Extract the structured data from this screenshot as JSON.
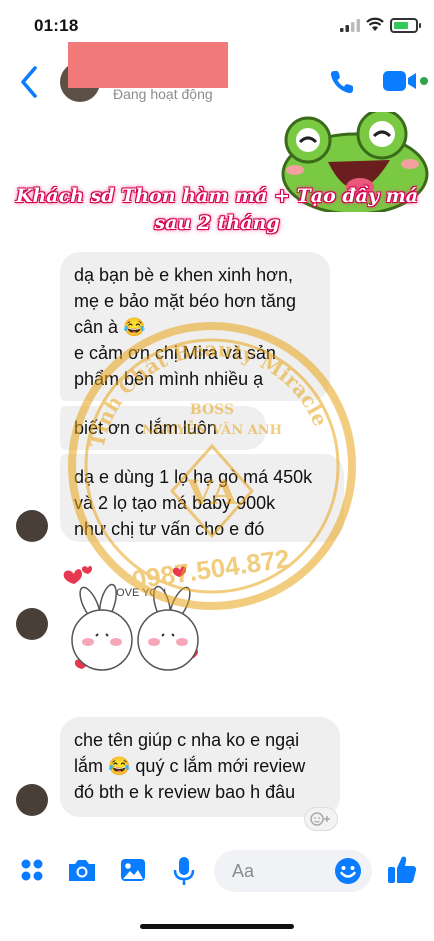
{
  "status_bar": {
    "time": "01:18"
  },
  "header": {
    "active_status": "Đang hoạt động"
  },
  "promo_text": {
    "line1": "Khách sd Thon hàm má + Tạo đầy má",
    "line2": "sau 2 tháng"
  },
  "messages": [
    {
      "lines": [
        "dạ bạn bè e khen xinh hơn,",
        "mẹ e bảo mặt béo hơn tăng",
        "cân à 😂",
        "e cảm ơn chị Mira và sản",
        "phẩm bên mình nhiều ạ"
      ]
    },
    {
      "lines": [
        "biết ơn c lắm luôn"
      ]
    },
    {
      "lines": [
        "dạ e dùng 1 lọ hạ gò má 450k",
        "và 2 lọ tạo má baby 900k",
        "như chị tư vấn cho e đó"
      ]
    },
    {
      "lines": [
        "che tên giúp c nha ko e ngại",
        "lắm 😂 quý c lắm mới review",
        "đó bth e k review bao h đâu"
      ]
    }
  ],
  "sticker": {
    "text": "LOVE YOU"
  },
  "watermark": {
    "brand": "Tinh Chất Beauty Miracle",
    "boss_label": "BOSS",
    "boss_name": "NGUYỄN VÂN ANH",
    "logo": "VA",
    "phone": "0987.504.872"
  },
  "composer": {
    "placeholder": "Aa"
  },
  "colors": {
    "messenger_blue": "#0a7cff",
    "bubble_gray": "#efefef",
    "promo_pink": "#d1004f",
    "watermark_gold": "#e8a317"
  }
}
